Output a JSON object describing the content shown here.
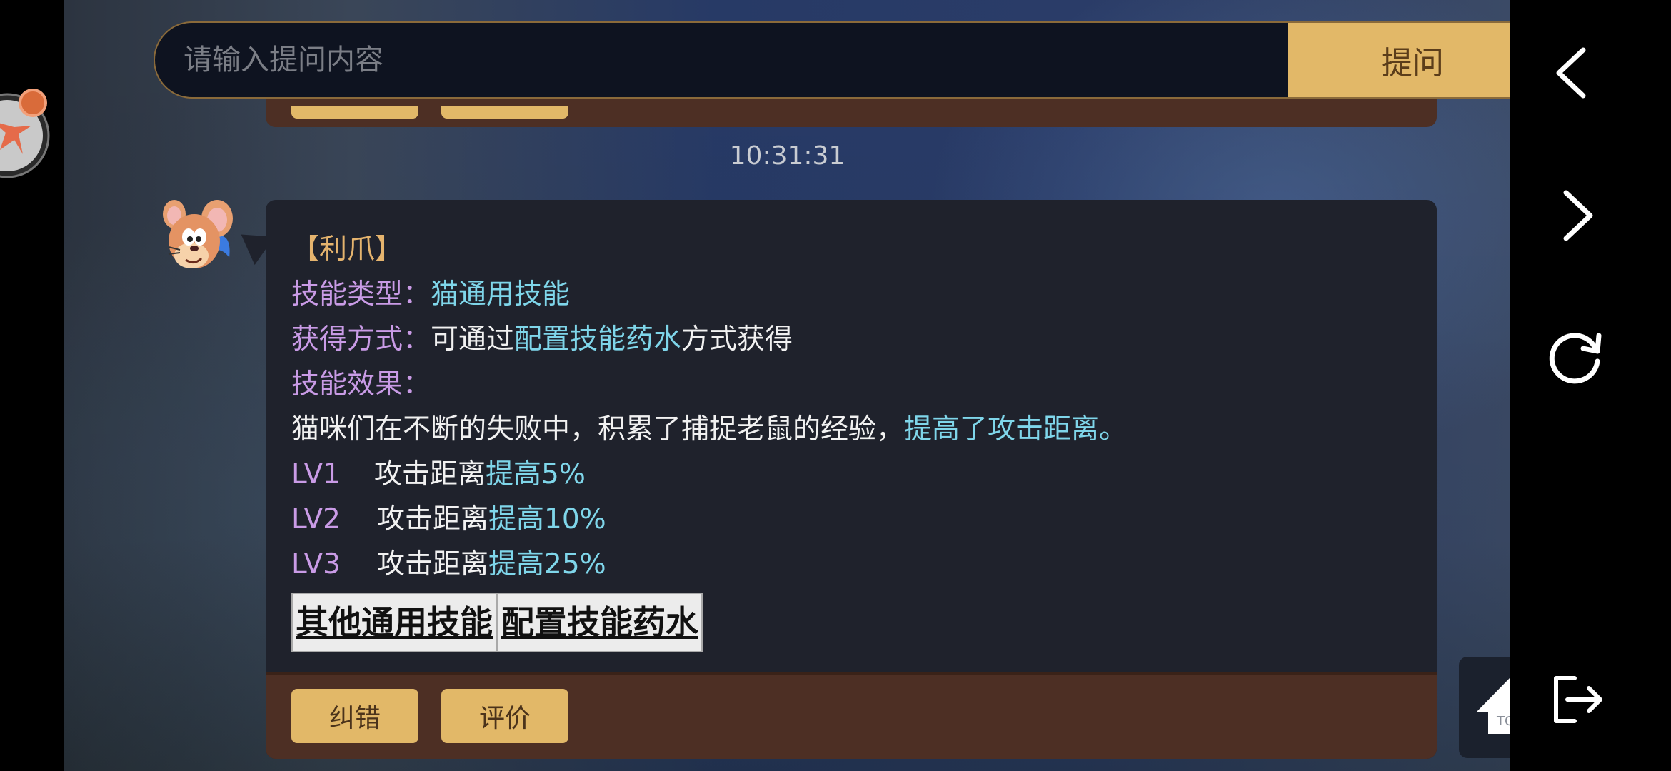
{
  "search": {
    "placeholder": "请输入提问内容",
    "ask_label": "提问"
  },
  "timestamp": "10:31:31",
  "message": {
    "title": "【利爪】",
    "skill_type_label": "技能类型：",
    "skill_type_value": "猫通用技能",
    "obtain_label": "获得方式：",
    "obtain_prefix": "可通过",
    "obtain_link": "配置技能药水",
    "obtain_suffix": "方式获得",
    "effect_label": "技能效果：",
    "desc_text": "猫咪们在不断的失败中，积累了捕捉老鼠的经验，",
    "desc_highlight": "提高了攻击距离。",
    "levels": [
      {
        "lv": "LV1",
        "text": "攻击距离",
        "value": "提高5%"
      },
      {
        "lv": "LV2",
        "text": "攻击距离",
        "value": "提高10%"
      },
      {
        "lv": "LV3",
        "text": "攻击距离",
        "value": "提高25%"
      }
    ],
    "links": [
      "其他通用技能",
      "配置技能药水"
    ]
  },
  "footer": {
    "correct_label": "纠错",
    "rate_label": "评价"
  },
  "top_button": {
    "label": "TOP"
  },
  "nav": {
    "icons": [
      "back-icon",
      "forward-icon",
      "refresh-icon",
      "exit-icon"
    ]
  },
  "colors": {
    "accent_gold": "#e2b868",
    "label_purple": "#c99be6",
    "highlight_cyan": "#7fd6ea",
    "title_gold": "#e5b46e",
    "footer_brown": "#4d2f24",
    "card_bg": "#1f222c"
  }
}
